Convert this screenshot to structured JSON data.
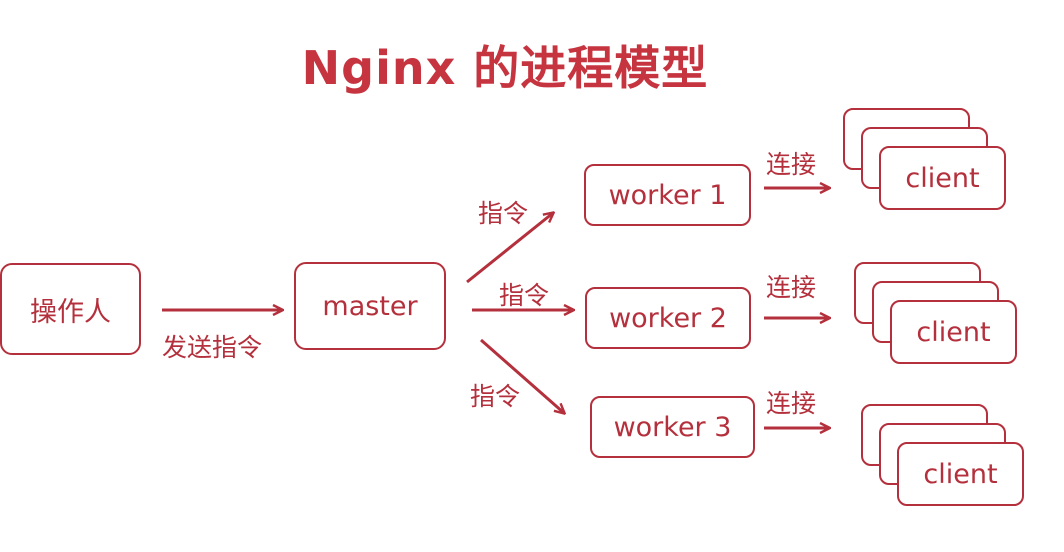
{
  "title": "Nginx 的进程模型",
  "nodes": {
    "operator": "操作人",
    "master": "master",
    "worker_1": "worker 1",
    "worker_2": "worker 2",
    "worker_3": "worker 3",
    "client_1": "client",
    "client_2": "client",
    "client_3": "client"
  },
  "edges": {
    "operator_to_master": "发送指令",
    "master_to_worker_1": "指令",
    "master_to_worker_2": "指令",
    "master_to_worker_3": "指令",
    "worker_1_to_client": "连接",
    "worker_2_to_client": "连接",
    "worker_3_to_client": "连接"
  },
  "colors": {
    "accent": "#b4303c",
    "title": "#c5343f"
  }
}
